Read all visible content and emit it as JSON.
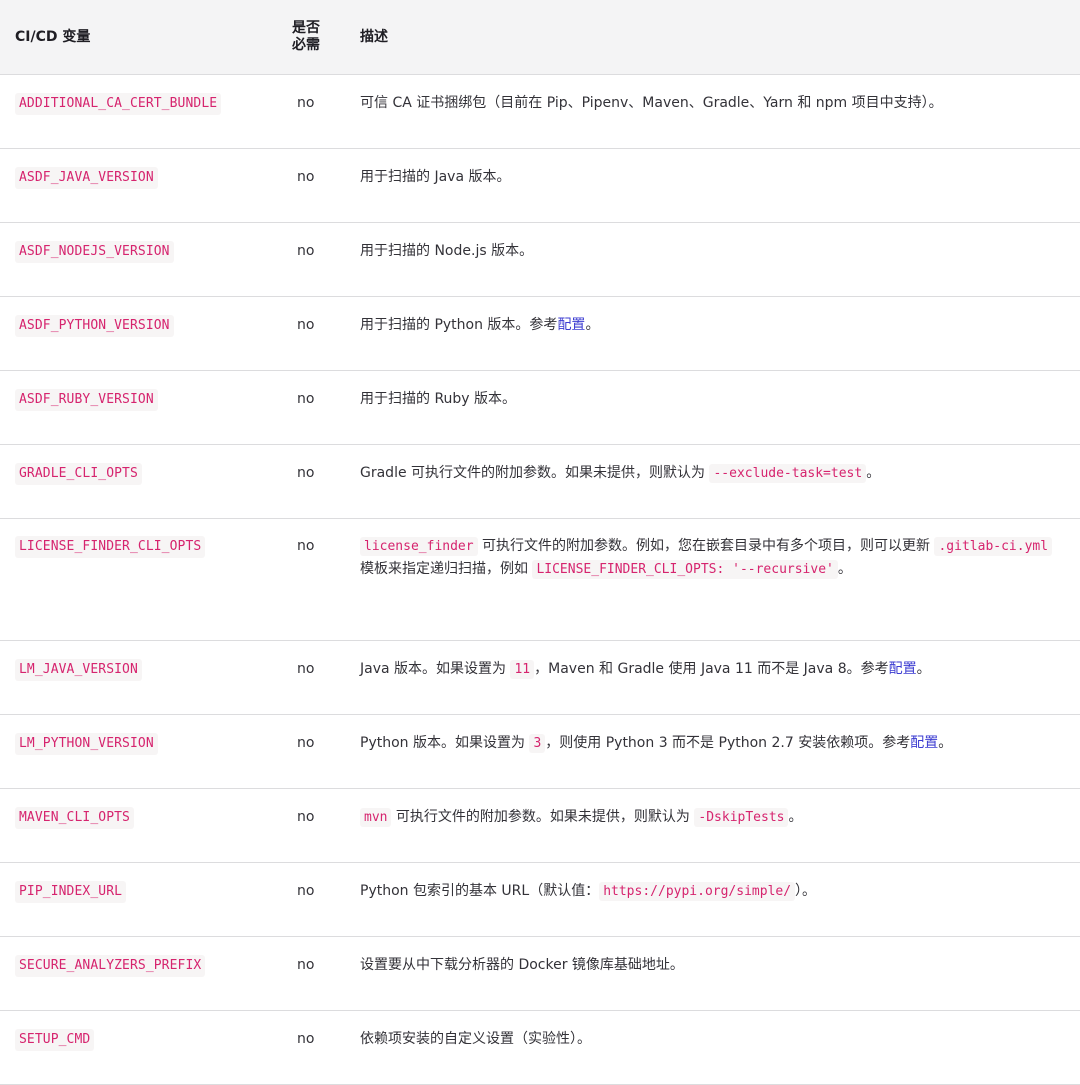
{
  "headers": {
    "variable": "CI/CD 变量",
    "required": "是否\n必需",
    "description": "描述"
  },
  "rows": [
    {
      "var": "ADDITIONAL_CA_CERT_BUNDLE",
      "req": "no",
      "desc": [
        {
          "t": "text",
          "v": "可信 CA 证书捆绑包（目前在 Pip、Pipenv、Maven、Gradle、Yarn 和 npm 项目中支持）。"
        }
      ]
    },
    {
      "var": "ASDF_JAVA_VERSION",
      "req": "no",
      "desc": [
        {
          "t": "text",
          "v": "用于扫描的 Java 版本。"
        }
      ]
    },
    {
      "var": "ASDF_NODEJS_VERSION",
      "req": "no",
      "desc": [
        {
          "t": "text",
          "v": "用于扫描的 Node.js 版本。"
        }
      ]
    },
    {
      "var": "ASDF_PYTHON_VERSION",
      "req": "no",
      "desc": [
        {
          "t": "text",
          "v": "用于扫描的 Python 版本。参考"
        },
        {
          "t": "link",
          "v": "配置"
        },
        {
          "t": "text",
          "v": "。"
        }
      ]
    },
    {
      "var": "ASDF_RUBY_VERSION",
      "req": "no",
      "desc": [
        {
          "t": "text",
          "v": "用于扫描的 Ruby 版本。"
        }
      ]
    },
    {
      "var": "GRADLE_CLI_OPTS",
      "req": "no",
      "desc": [
        {
          "t": "text",
          "v": "Gradle 可执行文件的附加参数。如果未提供，则默认为 "
        },
        {
          "t": "code",
          "v": "--exclude-task=test"
        },
        {
          "t": "text",
          "v": "。"
        }
      ]
    },
    {
      "var": "LICENSE_FINDER_CLI_OPTS",
      "req": "no",
      "desc": [
        {
          "t": "code",
          "v": "license_finder"
        },
        {
          "t": "text",
          "v": " 可执行文件的附加参数。例如，您在嵌套目录中有多个项目，则可以更新 "
        },
        {
          "t": "code",
          "v": ".gitlab-ci.yml"
        },
        {
          "t": "text",
          "v": " 模板来指定递归扫描，例如 "
        },
        {
          "t": "code",
          "v": "LICENSE_FINDER_CLI_OPTS: '--recursive'"
        },
        {
          "t": "text",
          "v": "。"
        }
      ]
    },
    {
      "var": "LM_JAVA_VERSION",
      "req": "no",
      "desc": [
        {
          "t": "text",
          "v": "Java 版本。如果设置为 "
        },
        {
          "t": "code",
          "v": "11"
        },
        {
          "t": "text",
          "v": "，Maven 和 Gradle 使用 Java 11 而不是 Java 8。参考"
        },
        {
          "t": "link",
          "v": "配置"
        },
        {
          "t": "text",
          "v": "。"
        }
      ]
    },
    {
      "var": "LM_PYTHON_VERSION",
      "req": "no",
      "desc": [
        {
          "t": "text",
          "v": "Python 版本。如果设置为 "
        },
        {
          "t": "code",
          "v": "3"
        },
        {
          "t": "text",
          "v": "，则使用 Python 3 而不是 Python 2.7 安装依赖项。参考"
        },
        {
          "t": "link",
          "v": "配置"
        },
        {
          "t": "text",
          "v": "。"
        }
      ]
    },
    {
      "var": "MAVEN_CLI_OPTS",
      "req": "no",
      "desc": [
        {
          "t": "code",
          "v": "mvn"
        },
        {
          "t": "text",
          "v": " 可执行文件的附加参数。如果未提供，则默认为 "
        },
        {
          "t": "code",
          "v": "-DskipTests"
        },
        {
          "t": "text",
          "v": "。"
        }
      ]
    },
    {
      "var": "PIP_INDEX_URL",
      "req": "no",
      "desc": [
        {
          "t": "text",
          "v": "Python 包索引的基本 URL（默认值："
        },
        {
          "t": "code",
          "v": "https://pypi.org/simple/"
        },
        {
          "t": "text",
          "v": "）。"
        }
      ]
    },
    {
      "var": "SECURE_ANALYZERS_PREFIX",
      "req": "no",
      "desc": [
        {
          "t": "text",
          "v": "设置要从中下载分析器的 Docker 镜像库基础地址。"
        }
      ]
    },
    {
      "var": "SETUP_CMD",
      "req": "no",
      "desc": [
        {
          "t": "text",
          "v": "依赖项安装的自定义设置（实验性）。"
        }
      ]
    }
  ]
}
